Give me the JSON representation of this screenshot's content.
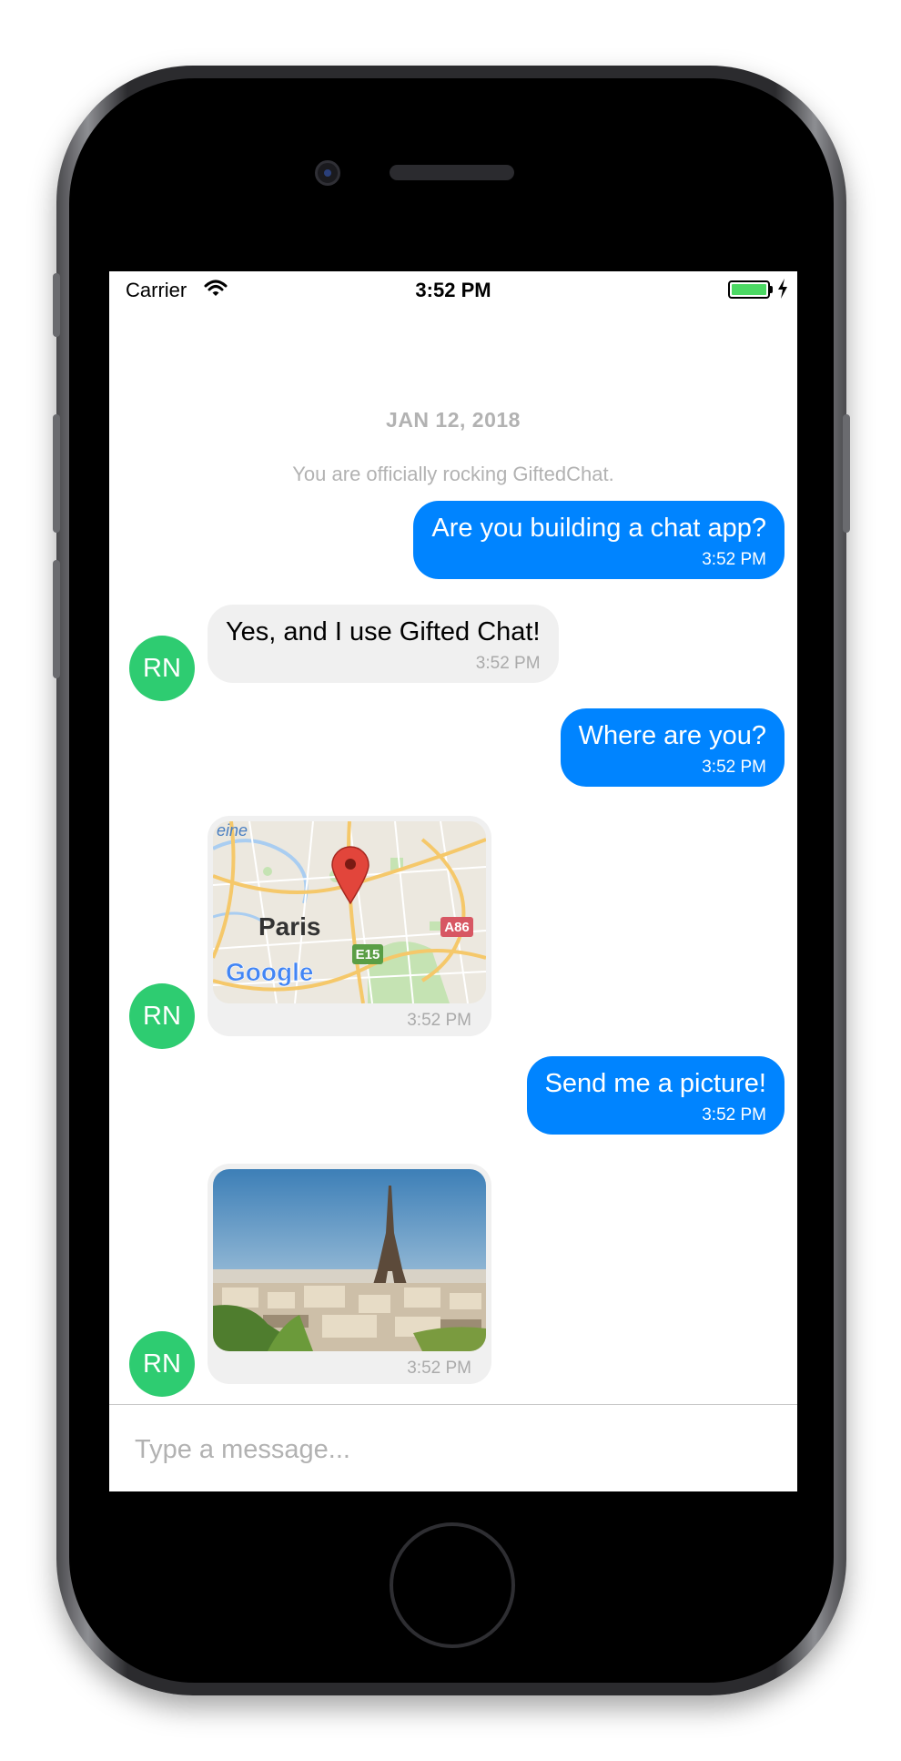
{
  "status_bar": {
    "carrier": "Carrier",
    "time": "3:52 PM",
    "battery_icon": "battery-full-icon",
    "wifi_icon": "wifi-icon",
    "charging_icon": "charging-bolt-icon"
  },
  "chat": {
    "date_header": "JAN 12, 2018",
    "system_message": "You are officially rocking GiftedChat.",
    "messages": [
      {
        "side": "right",
        "type": "text",
        "text": "Are you building a chat app?",
        "time": "3:52 PM"
      },
      {
        "side": "left",
        "type": "text",
        "text": "Yes, and I use Gifted Chat!",
        "time": "3:52 PM",
        "avatar": "RN"
      },
      {
        "side": "right",
        "type": "text",
        "text": "Where are you?",
        "time": "3:52 PM"
      },
      {
        "side": "left",
        "type": "location",
        "time": "3:52 PM",
        "avatar": "RN",
        "map": {
          "city_label": "Paris",
          "road_a86": "A86",
          "road_e15": "E15",
          "brand": "Google",
          "partial_label": "eine"
        }
      },
      {
        "side": "right",
        "type": "text",
        "text": "Send me a picture!",
        "time": "3:52 PM"
      },
      {
        "side": "left",
        "type": "image",
        "time": "3:52 PM",
        "avatar": "RN",
        "image_subject": "eiffel-tower-photo"
      }
    ]
  },
  "composer": {
    "placeholder": "Type a message..."
  },
  "colors": {
    "outgoing_bubble": "#0084ff",
    "incoming_bubble": "#f0f0f0",
    "avatar": "#2ecc71",
    "muted_text": "#b2b2b2",
    "battery": "#4cd964"
  }
}
